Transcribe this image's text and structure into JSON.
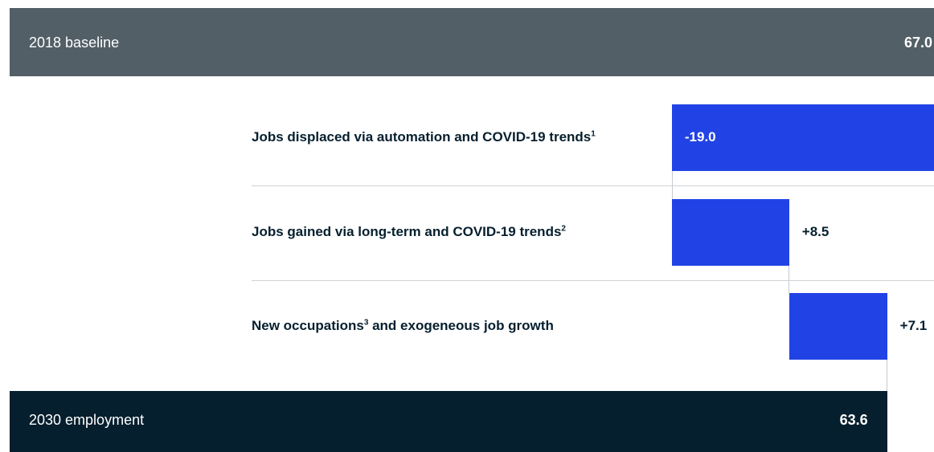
{
  "chart_data": {
    "type": "waterfall",
    "start": {
      "label": "2018 baseline",
      "value": 67.0,
      "display": "67.0"
    },
    "steps": [
      {
        "label": "Jobs displaced via automation and COVID-19 trends",
        "sup": "1",
        "label_tail": "",
        "value": -19.0,
        "display": "-19.0"
      },
      {
        "label": "Jobs gained via long-term and COVID-19 trends",
        "sup": "2",
        "label_tail": "",
        "value": 8.5,
        "display": "+8.5"
      },
      {
        "label": "New occupations",
        "sup": "3",
        "label_tail": " and exogeneous job growth",
        "value": 7.1,
        "display": "+7.1"
      }
    ],
    "end": {
      "label": "2030 employment",
      "value": 63.6,
      "display": "63.6"
    }
  },
  "colors": {
    "baseline_bar": "#525f67",
    "end_bar": "#061f2e",
    "step_bar": "#2143e5"
  }
}
